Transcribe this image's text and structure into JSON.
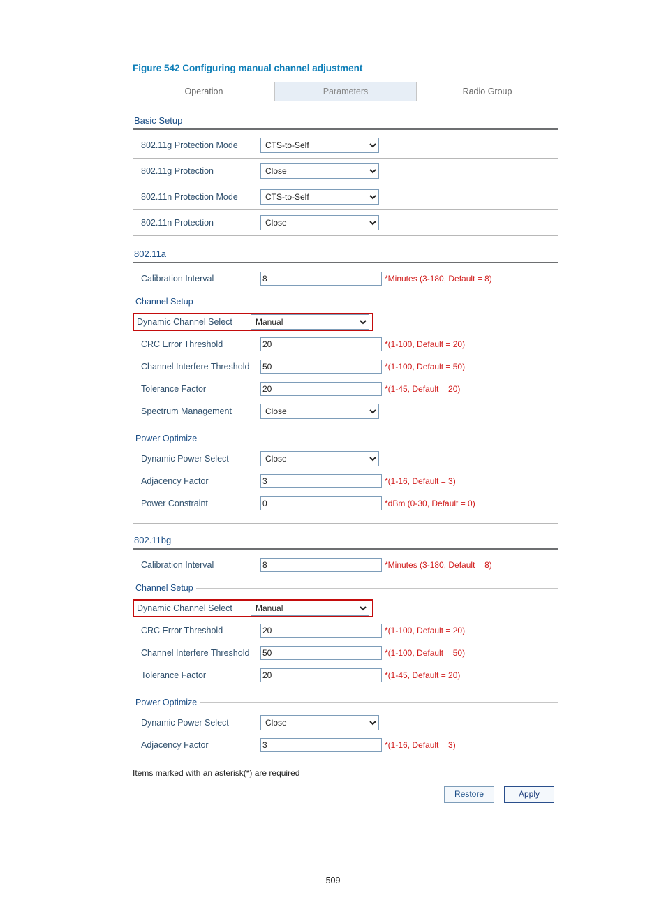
{
  "figure": {
    "label": "Figure 542",
    "title": "Configuring manual channel adjustment"
  },
  "tabs": {
    "operation": "Operation",
    "parameters": "Parameters",
    "radio_group": "Radio Group",
    "active": "Parameters"
  },
  "basic_setup": {
    "title": "Basic Setup",
    "g_prot_mode_label": "802.11g Protection Mode",
    "g_prot_mode_value": "CTS-to-Self",
    "g_prot_label": "802.11g Protection",
    "g_prot_value": "Close",
    "n_prot_mode_label": "802.11n Protection Mode",
    "n_prot_mode_value": "CTS-to-Self",
    "n_prot_label": "802.11n Protection",
    "n_prot_value": "Close"
  },
  "band_a": {
    "title": "802.11a",
    "calib_label": "Calibration Interval",
    "calib_value": "8",
    "calib_hint": "*Minutes (3-180, Default = 8)",
    "channel_setup_legend": "Channel Setup",
    "dyn_ch_label": "Dynamic Channel Select",
    "dyn_ch_value": "Manual",
    "crc_label": "CRC Error Threshold",
    "crc_value": "20",
    "crc_hint": "*(1-100, Default = 20)",
    "cit_label": "Channel Interfere Threshold",
    "cit_value": "50",
    "cit_hint": "*(1-100, Default = 50)",
    "tol_label": "Tolerance Factor",
    "tol_value": "20",
    "tol_hint": "*(1-45, Default = 20)",
    "spec_label": "Spectrum Management",
    "spec_value": "Close",
    "power_legend": "Power Optimize",
    "dps_label": "Dynamic Power Select",
    "dps_value": "Close",
    "adj_label": "Adjacency Factor",
    "adj_value": "3",
    "adj_hint": "*(1-16, Default = 3)",
    "pc_label": "Power Constraint",
    "pc_value": "0",
    "pc_hint": "*dBm (0-30, Default = 0)"
  },
  "band_bg": {
    "title": "802.11bg",
    "calib_label": "Calibration Interval",
    "calib_value": "8",
    "calib_hint": "*Minutes (3-180, Default = 8)",
    "channel_setup_legend": "Channel Setup",
    "dyn_ch_label": "Dynamic Channel Select",
    "dyn_ch_value": "Manual",
    "crc_label": "CRC Error Threshold",
    "crc_value": "20",
    "crc_hint": "*(1-100, Default = 20)",
    "cit_label": "Channel Interfere Threshold",
    "cit_value": "50",
    "cit_hint": "*(1-100, Default = 50)",
    "tol_label": "Tolerance Factor",
    "tol_value": "20",
    "tol_hint": "*(1-45, Default = 20)",
    "power_legend": "Power Optimize",
    "dps_label": "Dynamic Power Select",
    "dps_value": "Close",
    "adj_label": "Adjacency Factor",
    "adj_value": "3",
    "adj_hint": "*(1-16, Default = 3)"
  },
  "footnote": "Items marked with an asterisk(*) are required",
  "buttons": {
    "restore": "Restore",
    "apply": "Apply"
  },
  "page_number": "509"
}
